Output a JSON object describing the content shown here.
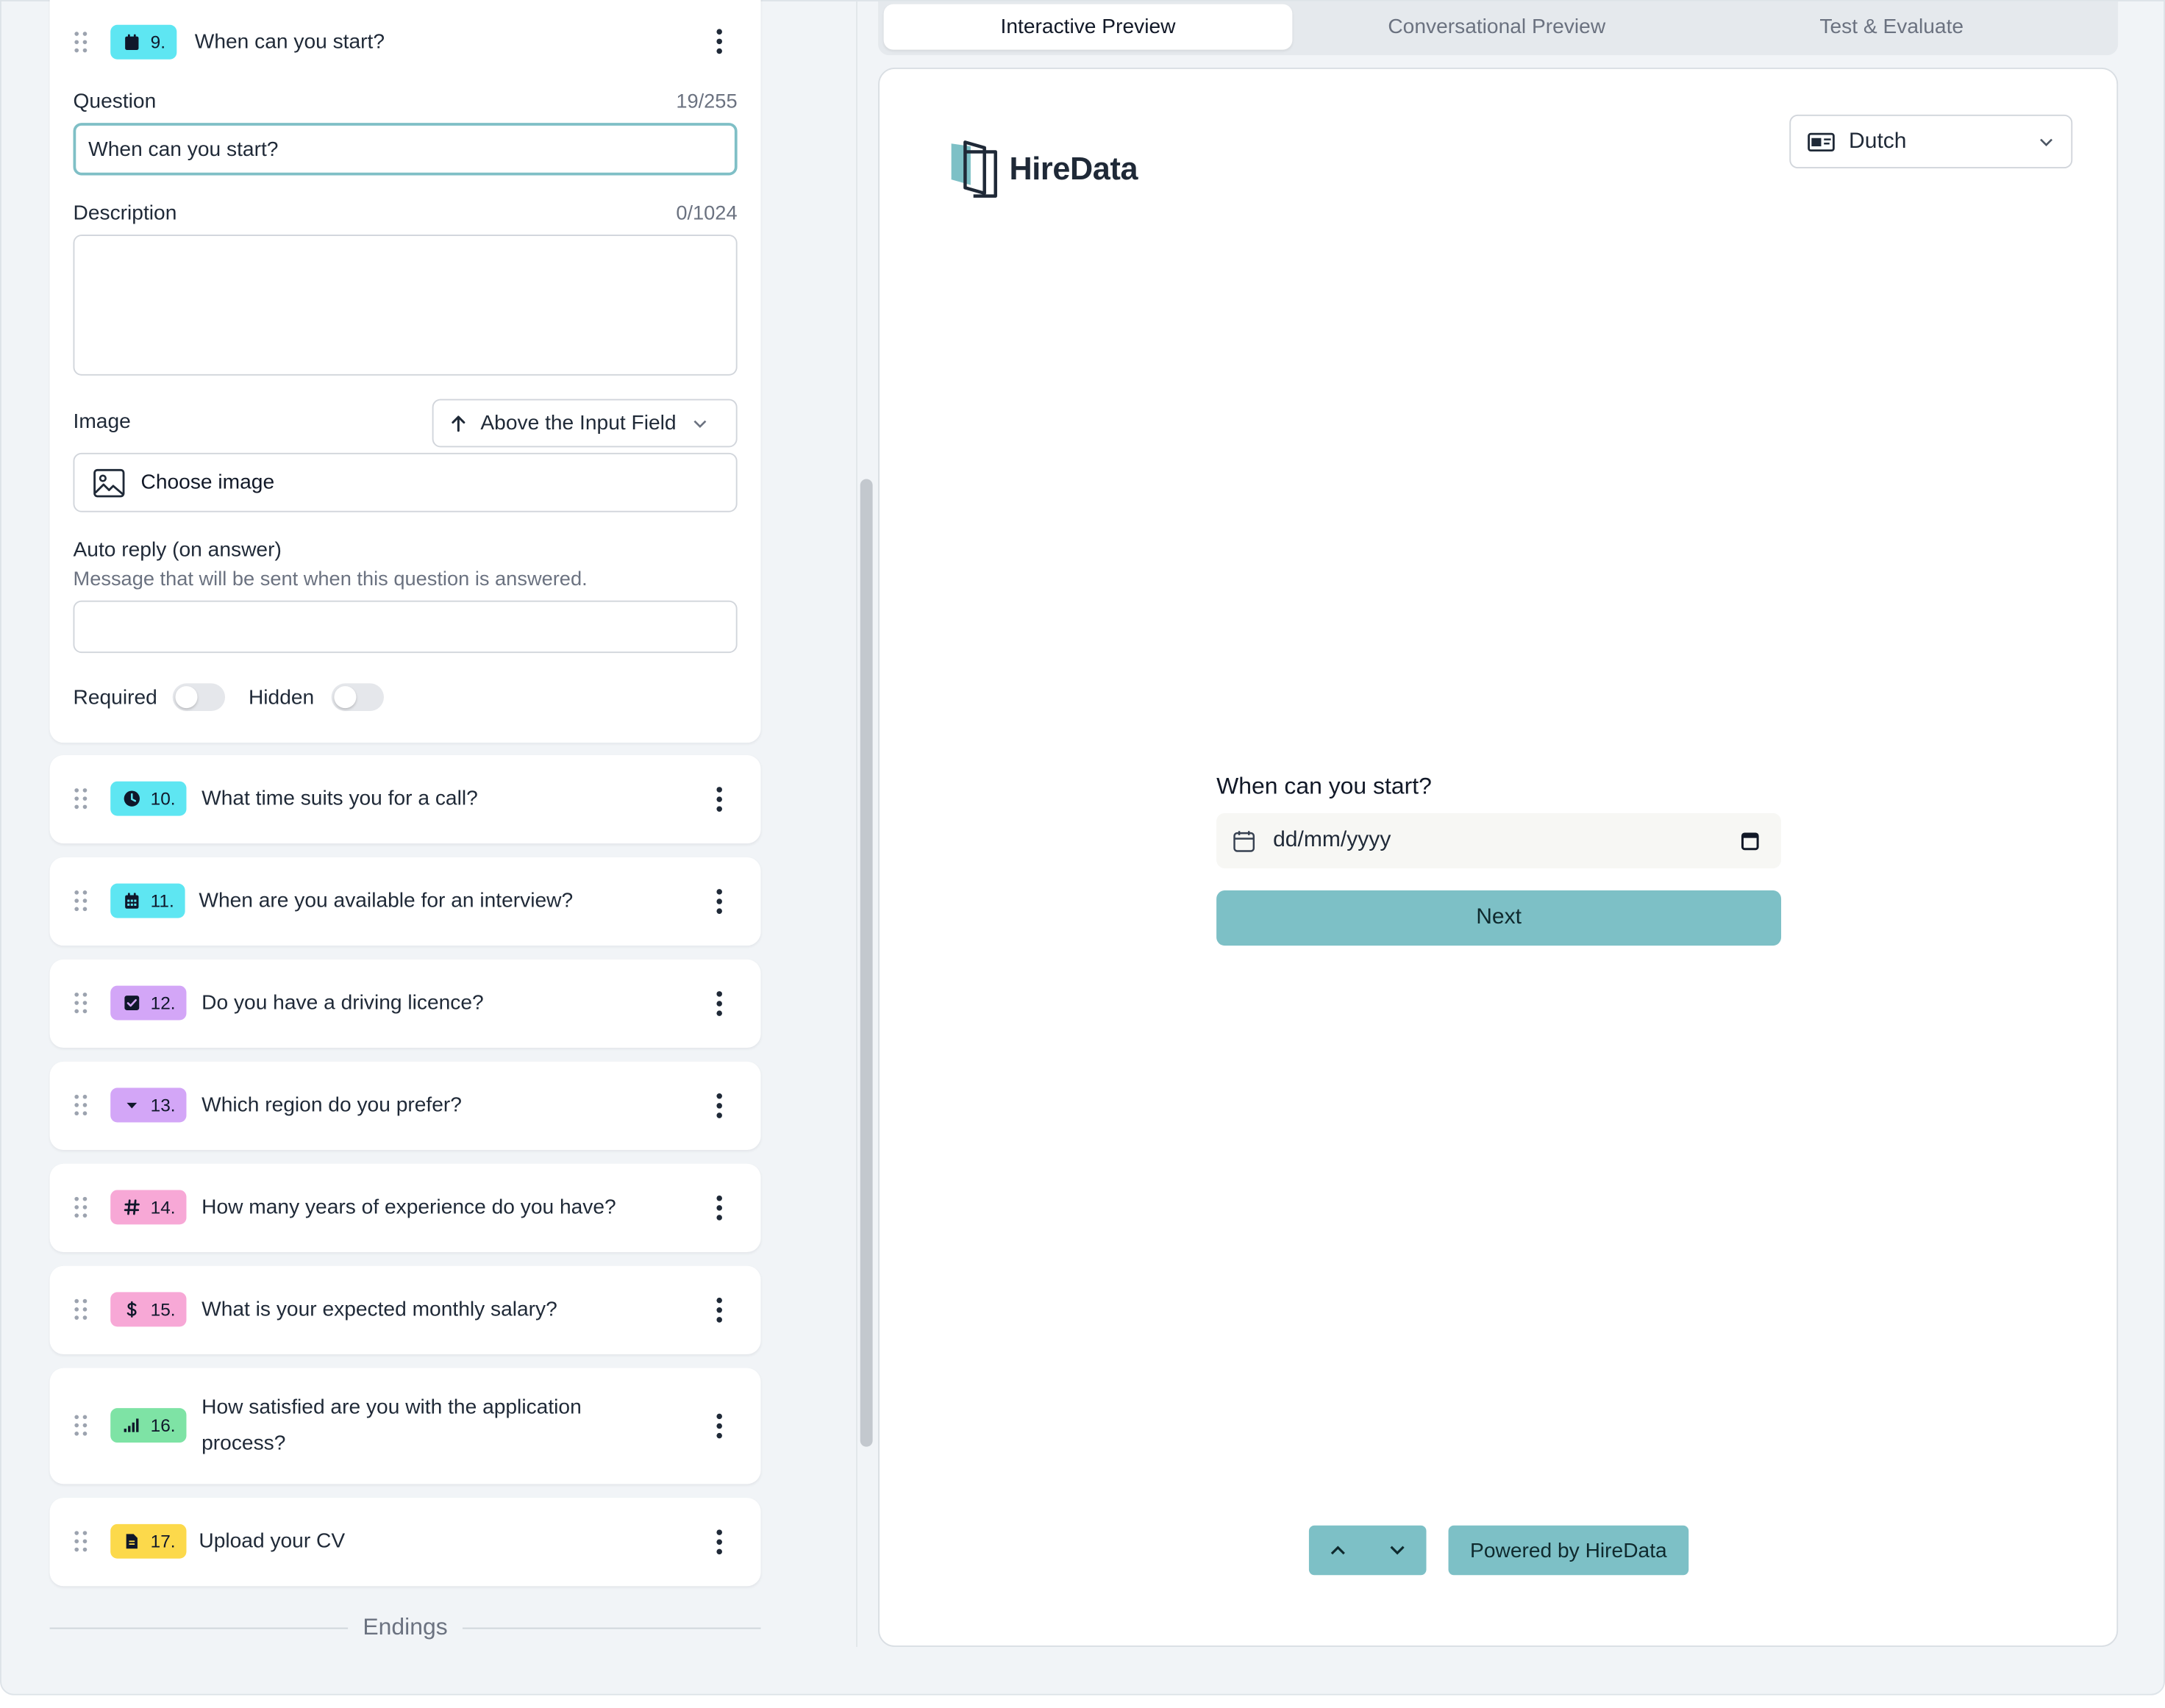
{
  "editor": {
    "active_question": {
      "number": "9.",
      "title": "When can you start?",
      "question_label": "Question",
      "question_count": "19/255",
      "question_value": "When can you start?",
      "description_label": "Description",
      "description_count": "0/1024",
      "description_value": "",
      "image_label": "Image",
      "image_position": "Above the Input Field",
      "choose_image": "Choose image",
      "auto_reply_label": "Auto reply (on answer)",
      "auto_reply_hint": "Message that will be sent when this question is answered.",
      "auto_reply_value": "",
      "required_label": "Required",
      "required_on": false,
      "hidden_label": "Hidden",
      "hidden_on": false
    },
    "questions": [
      {
        "number": "10.",
        "title": "What time suits you for a call?",
        "icon": "clock-icon",
        "color": "#5ee6f2"
      },
      {
        "number": "11.",
        "title": "When are you available for an interview?",
        "icon": "calendar-icon",
        "color": "#5ee6f2"
      },
      {
        "number": "12.",
        "title": "Do you have a driving licence?",
        "icon": "checkbox-icon",
        "color": "#d3a6f7"
      },
      {
        "number": "13.",
        "title": "Which region do you prefer?",
        "icon": "caret-down-icon",
        "color": "#d3a6f7"
      },
      {
        "number": "14.",
        "title": "How many years of experience do you have?",
        "icon": "hash-icon",
        "color": "#f7a8d6"
      },
      {
        "number": "15.",
        "title": "What is your expected monthly salary?",
        "icon": "dollar-icon",
        "color": "#f7a8d6"
      },
      {
        "number": "16.",
        "title_line1": "How satisfied are you with the application",
        "title_line2": "process?",
        "icon": "bar-chart-icon",
        "color": "#7ee3a5"
      },
      {
        "number": "17.",
        "title": "Upload your CV",
        "icon": "file-icon",
        "color": "#fcd94b"
      }
    ],
    "endings_label": "Endings"
  },
  "tabs": [
    "Interactive Preview",
    "Conversational Preview",
    "Test & Evaluate"
  ],
  "preview": {
    "brand": "HireData",
    "language": "Dutch",
    "question": "When can you start?",
    "date_placeholder": "dd/mm/yyyy",
    "next_label": "Next",
    "powered_by": "Powered by HireData"
  },
  "colors": {
    "accent": "#7dc0c6",
    "focus_border": "#7fbfc6",
    "background": "#f1f4f7"
  }
}
